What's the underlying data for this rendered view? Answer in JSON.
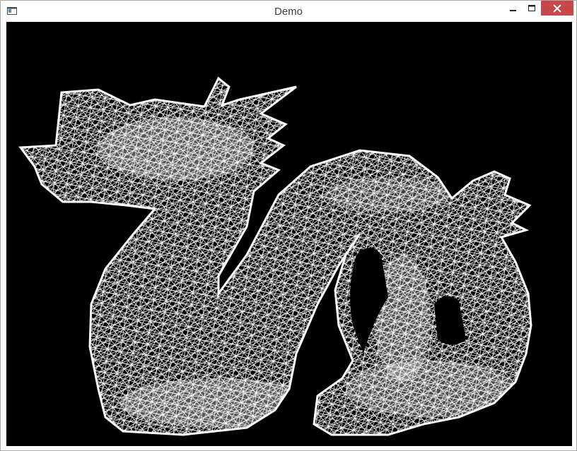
{
  "window": {
    "title": "Demo",
    "icon": "app-window-icon",
    "controls": [
      "minimize-icon",
      "maximize-icon",
      "close-icon"
    ],
    "close_color": "#c7474a"
  },
  "viewport": {
    "background": "#000000",
    "content": "dragon-wireframe-mesh",
    "mesh_color": "#ffffff"
  }
}
